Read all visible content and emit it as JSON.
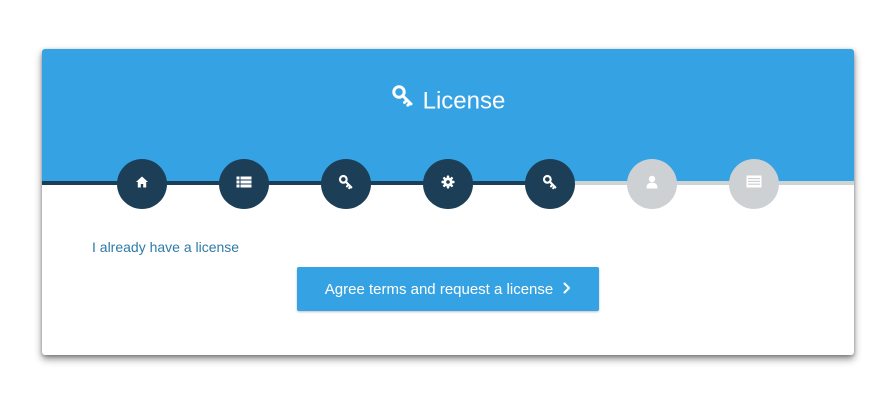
{
  "header": {
    "title": "License",
    "title_icon": "key-icon",
    "background": "#35a3e3"
  },
  "steps": [
    {
      "icon": "home-icon",
      "status": "completed"
    },
    {
      "icon": "list-icon",
      "status": "completed"
    },
    {
      "icon": "key-icon",
      "status": "completed"
    },
    {
      "icon": "gear-icon",
      "status": "completed"
    },
    {
      "icon": "key-icon",
      "status": "current"
    },
    {
      "icon": "user-icon",
      "status": "pending"
    },
    {
      "icon": "list-box-icon",
      "status": "pending"
    }
  ],
  "colors": {
    "accent": "#35a3e3",
    "step_done": "#1c3f57",
    "step_pending": "#cdd1d4",
    "link": "#2e7aa8"
  },
  "main": {
    "existing_license_link": "I already have a license",
    "request_button_label": "Agree terms and request a license",
    "request_button_icon": "chevron-right-icon"
  }
}
